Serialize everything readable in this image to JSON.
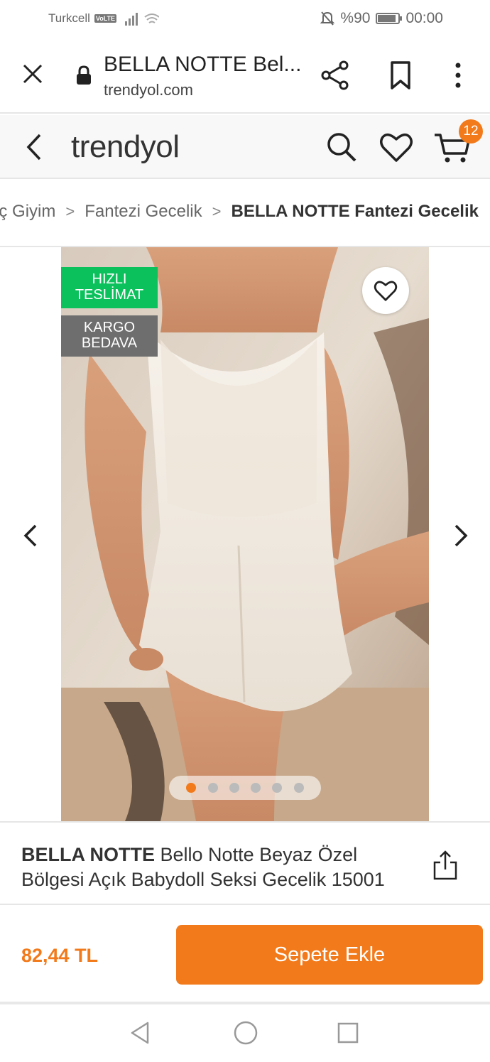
{
  "status_bar": {
    "carrier": "Turkcell",
    "network_badge": "VoLTE",
    "battery_text": "%90",
    "battery_level": 0.9,
    "time": "00:00",
    "icons": [
      "signal-icon",
      "wifi-icon",
      "mute-icon",
      "battery-icon"
    ]
  },
  "browser": {
    "page_title": "BELLA NOTTE Bel...",
    "url": "trendyol.com",
    "icons": [
      "close-icon",
      "lock-icon",
      "share-icon",
      "bookmark-icon",
      "more-icon"
    ]
  },
  "app_header": {
    "logo": "trendyol",
    "cart_count": "12",
    "icons": [
      "back-icon",
      "search-icon",
      "heart-icon",
      "cart-icon"
    ]
  },
  "breadcrumb": {
    "items": [
      "İç Giyim",
      "Fantezi Gecelik",
      "BELLA NOTTE Fantezi Gecelik"
    ]
  },
  "gallery": {
    "tag_fast_line1": "HIZLI",
    "tag_fast_line2": "TESLİMAT",
    "tag_free_line1": "KARGO",
    "tag_free_line2": "BEDAVA",
    "image_count": 6,
    "active_index": 0
  },
  "product": {
    "brand": "BELLA NOTTE",
    "name": "Bello Notte Beyaz Özel Bölgesi Açık Babydoll Seksi Gecelik 15001"
  },
  "buy": {
    "price": "82,44 TL",
    "add_to_cart": "Sepete Ekle"
  },
  "colors": {
    "accent": "#f27a1a",
    "fast_delivery": "#0bc15c",
    "free_shipping": "#6e6e6e"
  }
}
